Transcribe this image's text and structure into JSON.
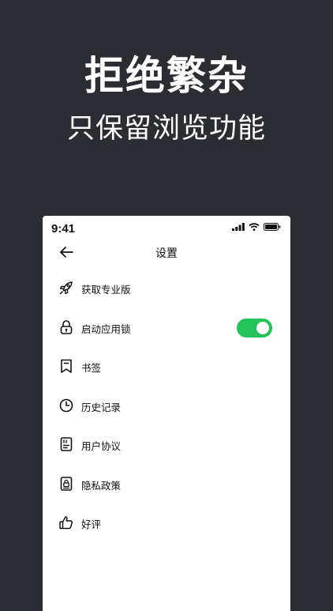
{
  "promo": {
    "headline": "拒绝繁杂",
    "subline": "只保留浏览功能"
  },
  "status_bar": {
    "time": "9:41",
    "icons": [
      "signal-icon",
      "wifi-icon",
      "battery-icon"
    ]
  },
  "nav": {
    "title": "设置",
    "back_icon": "arrow-left-icon"
  },
  "menu": {
    "items": [
      {
        "label": "获取专业版",
        "icon": "rocket-icon"
      },
      {
        "label": "启动应用锁",
        "icon": "lock-icon",
        "toggle_on": true
      },
      {
        "label": "书签",
        "icon": "bookmark-icon"
      },
      {
        "label": "历史记录",
        "icon": "clock-icon"
      },
      {
        "label": "用户协议",
        "icon": "document-icon"
      },
      {
        "label": "隐私政策",
        "icon": "privacy-lock-icon"
      },
      {
        "label": "好评",
        "icon": "thumbs-up-icon"
      }
    ]
  },
  "colors": {
    "background": "#2b2d33",
    "toggle_on": "#25c15a",
    "text": "#111111"
  }
}
